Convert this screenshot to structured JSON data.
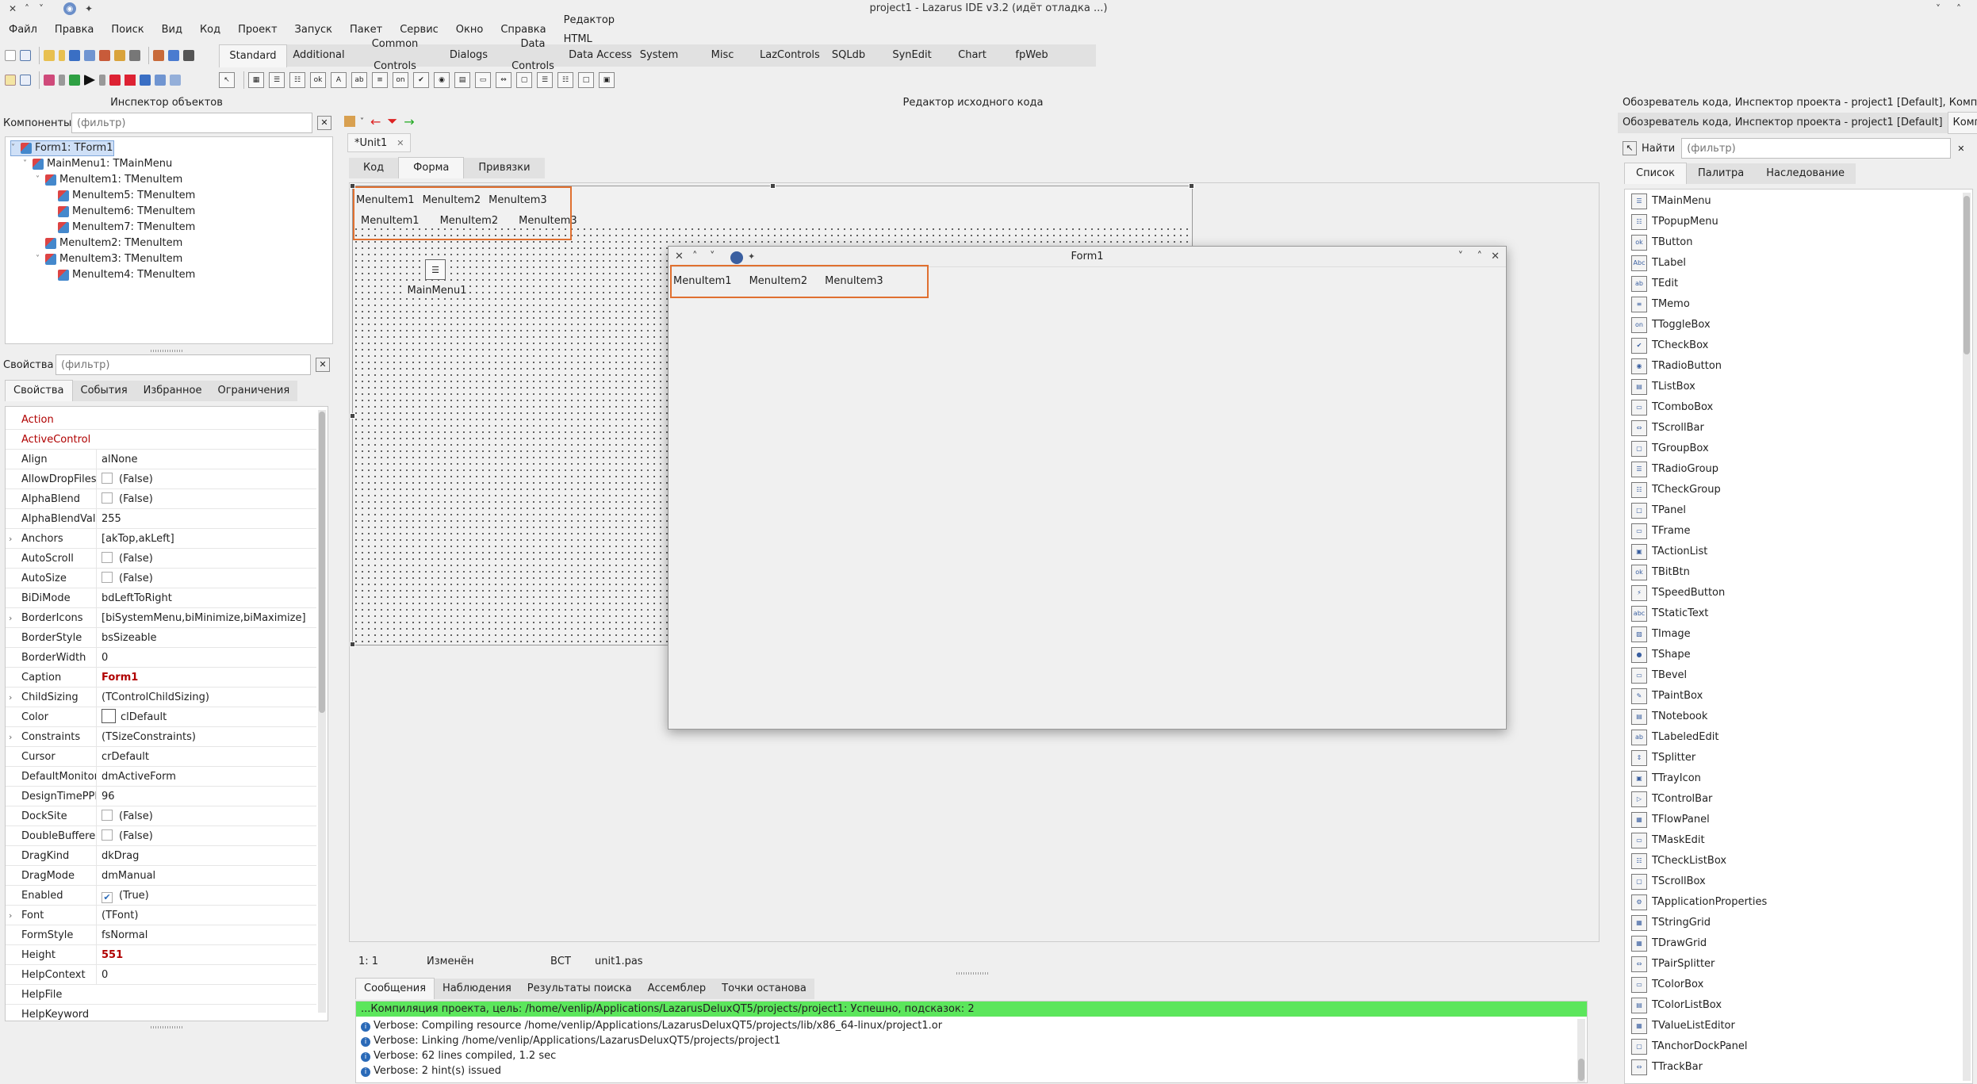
{
  "window": {
    "title": "project1 - Lazarus IDE v3.2 (идёт отладка ...)"
  },
  "menubar": [
    "Файл",
    "Правка",
    "Поиск",
    "Вид",
    "Код",
    "Проект",
    "Запуск",
    "Пакет",
    "Сервис",
    "Окно",
    "Справка",
    "Редактор HTML"
  ],
  "palette": {
    "tabs": [
      "Standard",
      "Additional",
      "Common Controls",
      "Dialogs",
      "Data Controls",
      "Data Access",
      "System",
      "Misc",
      "LazControls",
      "SQLdb",
      "SynEdit",
      "Chart",
      "fpWeb"
    ],
    "active_tab": "Standard",
    "icons": [
      "selection-arrow-icon",
      "frame-icon",
      "mainmenu-icon",
      "popupmenu-icon",
      "button-icon",
      "label-icon",
      "edit-icon",
      "memo-icon",
      "togglebox-icon",
      "checkbox-icon",
      "radiobutton-icon",
      "listbox-icon",
      "combobox-icon",
      "scrollbar-icon",
      "groupbox-icon",
      "radiogroup-icon",
      "checkgroup-icon",
      "panel-icon",
      "actionlist-icon"
    ]
  },
  "inspector": {
    "title": "Инспектор объектов",
    "components_label": "Компоненты",
    "filter_placeholder": "(фильтр)",
    "tree": [
      {
        "label": "Form1: TForm1",
        "level": 0
      },
      {
        "label": "MainMenu1: TMainMenu",
        "level": 1
      },
      {
        "label": "MenuItem1: TMenuItem",
        "level": 2
      },
      {
        "label": "MenuItem5: TMenuItem",
        "level": 3
      },
      {
        "label": "MenuItem6: TMenuItem",
        "level": 3
      },
      {
        "label": "MenuItem7: TMenuItem",
        "level": 3
      },
      {
        "label": "MenuItem2: TMenuItem",
        "level": 2
      },
      {
        "label": "MenuItem3: TMenuItem",
        "level": 2
      },
      {
        "label": "MenuItem4: TMenuItem",
        "level": 3
      }
    ],
    "properties_label": "Свойства",
    "tabs": [
      "Свойства",
      "События",
      "Избранное",
      "Ограничения"
    ],
    "properties": [
      {
        "name": "Action",
        "value": "",
        "red": true
      },
      {
        "name": "ActiveControl",
        "value": "",
        "red": true
      },
      {
        "name": "Align",
        "value": "alNone"
      },
      {
        "name": "AllowDropFiles",
        "value": "(False)",
        "checkbox": true
      },
      {
        "name": "AlphaBlend",
        "value": "(False)",
        "checkbox": true
      },
      {
        "name": "AlphaBlendValu",
        "value": "255"
      },
      {
        "name": "Anchors",
        "value": "[akTop,akLeft]",
        "expand": true
      },
      {
        "name": "AutoScroll",
        "value": "(False)",
        "checkbox": true
      },
      {
        "name": "AutoSize",
        "value": "(False)",
        "checkbox": true
      },
      {
        "name": "BiDiMode",
        "value": "bdLeftToRight"
      },
      {
        "name": "BorderIcons",
        "value": "[biSystemMenu,biMinimize,biMaximize]",
        "expand": true
      },
      {
        "name": "BorderStyle",
        "value": "bsSizeable"
      },
      {
        "name": "BorderWidth",
        "value": "0"
      },
      {
        "name": "Caption",
        "value": "Form1",
        "valuered": true
      },
      {
        "name": "ChildSizing",
        "value": "(TControlChildSizing)",
        "expand": true
      },
      {
        "name": "Color",
        "value": "clDefault",
        "swatch": true
      },
      {
        "name": "Constraints",
        "value": "(TSizeConstraints)",
        "expand": true
      },
      {
        "name": "Cursor",
        "value": "crDefault"
      },
      {
        "name": "DefaultMonitor",
        "value": "dmActiveForm"
      },
      {
        "name": "DesignTimePPI",
        "value": "96"
      },
      {
        "name": "DockSite",
        "value": "(False)",
        "checkbox": true
      },
      {
        "name": "DoubleBuffered",
        "value": "(False)",
        "checkbox": true
      },
      {
        "name": "DragKind",
        "value": "dkDrag"
      },
      {
        "name": "DragMode",
        "value": "dmManual"
      },
      {
        "name": "Enabled",
        "value": "(True)",
        "checkbox": true,
        "checked": true
      },
      {
        "name": "Font",
        "value": "(TFont)",
        "expand": true
      },
      {
        "name": "FormStyle",
        "value": "fsNormal"
      },
      {
        "name": "Height",
        "value": "551",
        "valuered": true
      },
      {
        "name": "HelpContext",
        "value": "0"
      },
      {
        "name": "HelpFile",
        "value": ""
      },
      {
        "name": "HelpKeyword",
        "value": ""
      }
    ]
  },
  "editor": {
    "title": "Редактор исходного кода",
    "file_tab": "*Unit1",
    "view_tabs": [
      "Код",
      "Форма",
      "Привязки"
    ],
    "active_view": "Форма",
    "designer_menu_row1": [
      "MenuItem1",
      "MenuItem2",
      "MenuItem3"
    ],
    "designer_menu_row2": [
      "MenuItem1",
      "MenuItem2",
      "MenuItem3"
    ],
    "component_label": "MainMenu1",
    "status": {
      "pos": "1:    1",
      "modified": "Изменён",
      "mode": "ВСТ",
      "file": "unit1.pas"
    }
  },
  "runtime_form": {
    "title": "Form1",
    "menu": [
      "MenuItem1",
      "MenuItem2",
      "MenuItem3"
    ]
  },
  "messages": {
    "tabs": [
      "Сообщения",
      "Наблюдения",
      "Результаты поиска",
      "Ассемблер",
      "Точки останова"
    ],
    "active_tab": "Сообщения",
    "success": "...Компиляция проекта, цель: /home/venlip/Applications/LazarusDeluxQT5/projects/project1: Успешно, подсказок: 2",
    "lines": [
      "Verbose: Compiling resource /home/venlip/Applications/LazarusDeluxQT5/projects/lib/x86_64-linux/project1.or",
      "Verbose: Linking /home/venlip/Applications/LazarusDeluxQT5/projects/project1",
      "Verbose: 62 lines compiled, 1.2 sec",
      "Verbose: 2 hint(s) issued"
    ],
    "success_color": "#5ce65c"
  },
  "right_panel": {
    "title": "Обозреватель кода, Инспектор проекта - project1 [Default], Компоненты",
    "tab1": "Обозреватель кода, Инспектор проекта - project1 [Default]",
    "tab2": "Компоненты",
    "find_label": "Найти",
    "filter_placeholder": "(фильтр)",
    "view_tabs": [
      "Список",
      "Палитра",
      "Наследование"
    ],
    "active_view": "Список",
    "components": [
      "TMainMenu",
      "TPopupMenu",
      "TButton",
      "TLabel",
      "TEdit",
      "TMemo",
      "TToggleBox",
      "TCheckBox",
      "TRadioButton",
      "TListBox",
      "TComboBox",
      "TScrollBar",
      "TGroupBox",
      "TRadioGroup",
      "TCheckGroup",
      "TPanel",
      "TFrame",
      "TActionList",
      "TBitBtn",
      "TSpeedButton",
      "TStaticText",
      "TImage",
      "TShape",
      "TBevel",
      "TPaintBox",
      "TNotebook",
      "TLabeledEdit",
      "TSplitter",
      "TTrayIcon",
      "TControlBar",
      "TFlowPanel",
      "TMaskEdit",
      "TCheckListBox",
      "TScrollBox",
      "TApplicationProperties",
      "TStringGrid",
      "TDrawGrid",
      "TPairSplitter",
      "TColorBox",
      "TColorListBox",
      "TValueListEditor",
      "TAnchorDockPanel",
      "TTrackBar"
    ]
  }
}
